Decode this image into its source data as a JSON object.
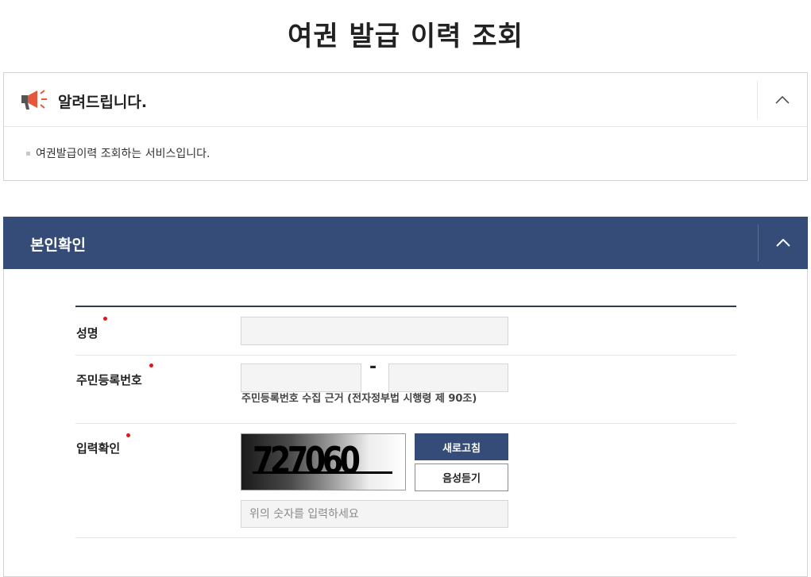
{
  "page_title": "여권 발급 이력 조회",
  "notice": {
    "icon": "megaphone-icon",
    "title": "알려드립니다.",
    "toggle_icon": "chevron-up-icon",
    "items": [
      "여권발급이력 조회하는 서비스입니다."
    ]
  },
  "verify": {
    "title": "본인확인",
    "toggle_icon": "chevron-up-icon",
    "header_color": "#344c77",
    "required_color": "#e0161d",
    "fields": {
      "name": {
        "label": "성명",
        "value": "",
        "placeholder": ""
      },
      "rrn": {
        "label": "주민등록번호",
        "first_value": "",
        "second_value": "",
        "separator": "-",
        "note": "주민등록번호 수집 근거 (전자정부법 시행령 제 90조)"
      },
      "captcha": {
        "label": "입력확인",
        "image_text": "727060",
        "refresh_label": "새로고침",
        "audio_label": "음성듣기",
        "placeholder": "위의 숫자를 입력하세요"
      }
    }
  }
}
